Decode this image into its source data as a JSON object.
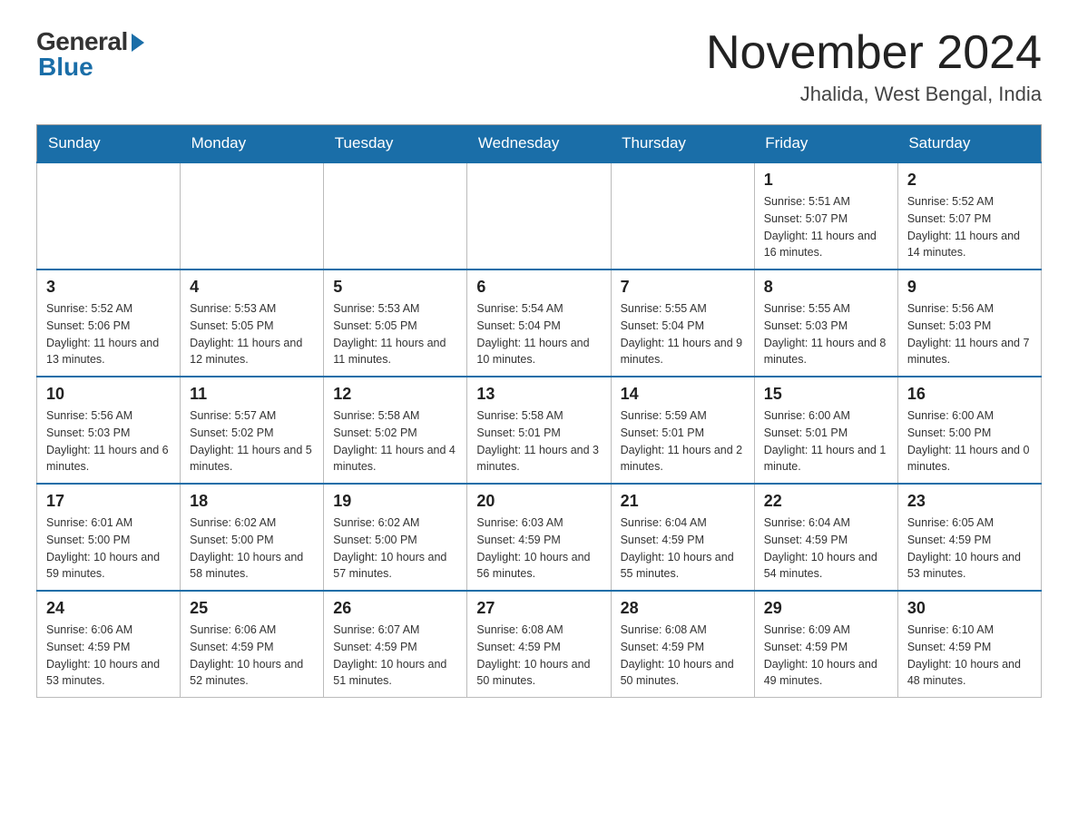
{
  "logo": {
    "general": "General",
    "blue": "Blue"
  },
  "header": {
    "month_year": "November 2024",
    "location": "Jhalida, West Bengal, India"
  },
  "days_of_week": [
    "Sunday",
    "Monday",
    "Tuesday",
    "Wednesday",
    "Thursday",
    "Friday",
    "Saturday"
  ],
  "weeks": [
    [
      {
        "day": "",
        "info": ""
      },
      {
        "day": "",
        "info": ""
      },
      {
        "day": "",
        "info": ""
      },
      {
        "day": "",
        "info": ""
      },
      {
        "day": "",
        "info": ""
      },
      {
        "day": "1",
        "info": "Sunrise: 5:51 AM\nSunset: 5:07 PM\nDaylight: 11 hours and 16 minutes."
      },
      {
        "day": "2",
        "info": "Sunrise: 5:52 AM\nSunset: 5:07 PM\nDaylight: 11 hours and 14 minutes."
      }
    ],
    [
      {
        "day": "3",
        "info": "Sunrise: 5:52 AM\nSunset: 5:06 PM\nDaylight: 11 hours and 13 minutes."
      },
      {
        "day": "4",
        "info": "Sunrise: 5:53 AM\nSunset: 5:05 PM\nDaylight: 11 hours and 12 minutes."
      },
      {
        "day": "5",
        "info": "Sunrise: 5:53 AM\nSunset: 5:05 PM\nDaylight: 11 hours and 11 minutes."
      },
      {
        "day": "6",
        "info": "Sunrise: 5:54 AM\nSunset: 5:04 PM\nDaylight: 11 hours and 10 minutes."
      },
      {
        "day": "7",
        "info": "Sunrise: 5:55 AM\nSunset: 5:04 PM\nDaylight: 11 hours and 9 minutes."
      },
      {
        "day": "8",
        "info": "Sunrise: 5:55 AM\nSunset: 5:03 PM\nDaylight: 11 hours and 8 minutes."
      },
      {
        "day": "9",
        "info": "Sunrise: 5:56 AM\nSunset: 5:03 PM\nDaylight: 11 hours and 7 minutes."
      }
    ],
    [
      {
        "day": "10",
        "info": "Sunrise: 5:56 AM\nSunset: 5:03 PM\nDaylight: 11 hours and 6 minutes."
      },
      {
        "day": "11",
        "info": "Sunrise: 5:57 AM\nSunset: 5:02 PM\nDaylight: 11 hours and 5 minutes."
      },
      {
        "day": "12",
        "info": "Sunrise: 5:58 AM\nSunset: 5:02 PM\nDaylight: 11 hours and 4 minutes."
      },
      {
        "day": "13",
        "info": "Sunrise: 5:58 AM\nSunset: 5:01 PM\nDaylight: 11 hours and 3 minutes."
      },
      {
        "day": "14",
        "info": "Sunrise: 5:59 AM\nSunset: 5:01 PM\nDaylight: 11 hours and 2 minutes."
      },
      {
        "day": "15",
        "info": "Sunrise: 6:00 AM\nSunset: 5:01 PM\nDaylight: 11 hours and 1 minute."
      },
      {
        "day": "16",
        "info": "Sunrise: 6:00 AM\nSunset: 5:00 PM\nDaylight: 11 hours and 0 minutes."
      }
    ],
    [
      {
        "day": "17",
        "info": "Sunrise: 6:01 AM\nSunset: 5:00 PM\nDaylight: 10 hours and 59 minutes."
      },
      {
        "day": "18",
        "info": "Sunrise: 6:02 AM\nSunset: 5:00 PM\nDaylight: 10 hours and 58 minutes."
      },
      {
        "day": "19",
        "info": "Sunrise: 6:02 AM\nSunset: 5:00 PM\nDaylight: 10 hours and 57 minutes."
      },
      {
        "day": "20",
        "info": "Sunrise: 6:03 AM\nSunset: 4:59 PM\nDaylight: 10 hours and 56 minutes."
      },
      {
        "day": "21",
        "info": "Sunrise: 6:04 AM\nSunset: 4:59 PM\nDaylight: 10 hours and 55 minutes."
      },
      {
        "day": "22",
        "info": "Sunrise: 6:04 AM\nSunset: 4:59 PM\nDaylight: 10 hours and 54 minutes."
      },
      {
        "day": "23",
        "info": "Sunrise: 6:05 AM\nSunset: 4:59 PM\nDaylight: 10 hours and 53 minutes."
      }
    ],
    [
      {
        "day": "24",
        "info": "Sunrise: 6:06 AM\nSunset: 4:59 PM\nDaylight: 10 hours and 53 minutes."
      },
      {
        "day": "25",
        "info": "Sunrise: 6:06 AM\nSunset: 4:59 PM\nDaylight: 10 hours and 52 minutes."
      },
      {
        "day": "26",
        "info": "Sunrise: 6:07 AM\nSunset: 4:59 PM\nDaylight: 10 hours and 51 minutes."
      },
      {
        "day": "27",
        "info": "Sunrise: 6:08 AM\nSunset: 4:59 PM\nDaylight: 10 hours and 50 minutes."
      },
      {
        "day": "28",
        "info": "Sunrise: 6:08 AM\nSunset: 4:59 PM\nDaylight: 10 hours and 50 minutes."
      },
      {
        "day": "29",
        "info": "Sunrise: 6:09 AM\nSunset: 4:59 PM\nDaylight: 10 hours and 49 minutes."
      },
      {
        "day": "30",
        "info": "Sunrise: 6:10 AM\nSunset: 4:59 PM\nDaylight: 10 hours and 48 minutes."
      }
    ]
  ]
}
